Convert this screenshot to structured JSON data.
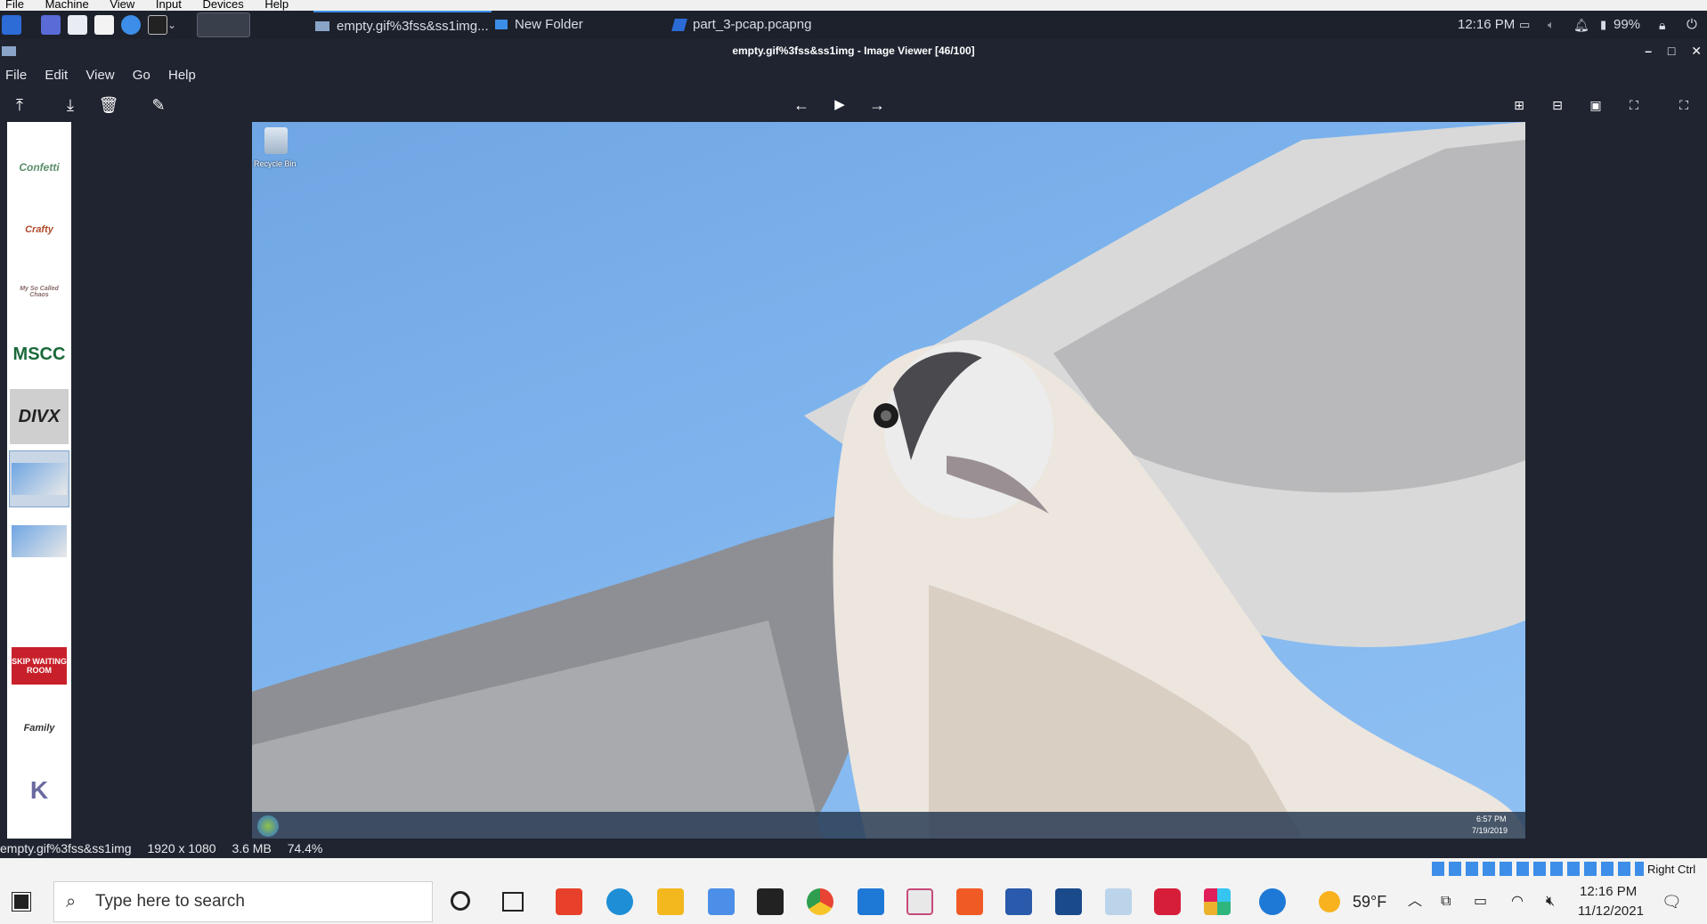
{
  "vbox_menu": [
    "File",
    "Machine",
    "View",
    "Input",
    "Devices",
    "Help"
  ],
  "panel": {
    "tasks": [
      {
        "label": "empty.gif%3fss&ss1img..."
      },
      {
        "label": "New Folder"
      },
      {
        "label": "part_3-pcap.pcapng"
      }
    ],
    "clock": "12:16 PM",
    "battery": "99%"
  },
  "window": {
    "title": "empty.gif%3fss&ss1img - Image Viewer [46/100]"
  },
  "app_menu": [
    "File",
    "Edit",
    "View",
    "Go",
    "Help"
  ],
  "thumbnails": [
    {
      "text": "Confetti",
      "color": "#5a8f6b"
    },
    {
      "text": "Crafty",
      "color": "#b04a2a"
    },
    {
      "text": "My So Called Chaos",
      "color": "#8a6a6a"
    },
    {
      "text": "MSCC",
      "color": "#1a6a3a"
    },
    {
      "text": "DIVX",
      "color": "#222222"
    },
    {
      "text": "",
      "color": "#6fa6e3"
    },
    {
      "text": "",
      "color": "#6fa6e3"
    },
    {
      "text": "SKIP WAITING ROOM",
      "color": "#c8202a"
    },
    {
      "text": "Family",
      "color": "#333333"
    },
    {
      "text": "K",
      "color": "#6a6aa0"
    }
  ],
  "embedded": {
    "desktop_icon_label": "Recycle Bin",
    "clock_time": "6:57 PM",
    "clock_date": "7/19/2019"
  },
  "status": {
    "filename": "empty.gif%3fss&ss1img",
    "dimensions": "1920 x 1080",
    "size": "3.6 MB",
    "zoom": "74.4%"
  },
  "host_tray": {
    "right_ctrl": "Right Ctrl"
  },
  "taskbar": {
    "search_placeholder": "Type here to search",
    "weather": "59°F",
    "time": "12:16 PM",
    "date": "11/12/2021"
  }
}
